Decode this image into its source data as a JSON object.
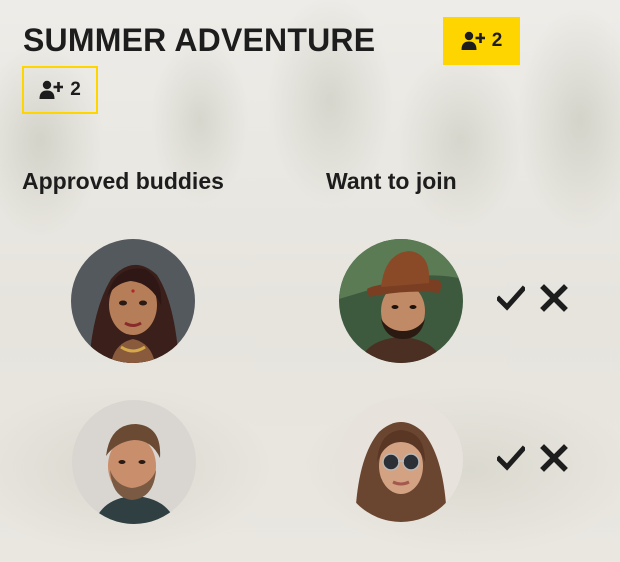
{
  "trip": {
    "title": "SUMMER ADVENTURE"
  },
  "badges": {
    "approved_count": "2",
    "requests_count": "2",
    "icon": "user-plus-icon",
    "accent_color": "#ffd500"
  },
  "columns": {
    "approved_heading": "Approved buddies",
    "want_heading": "Want to join"
  },
  "approved_buddies": [
    {
      "avatar": "avatar-woman-dark-hair"
    },
    {
      "avatar": "avatar-man-beard"
    }
  ],
  "join_requests": [
    {
      "avatar": "avatar-man-hat",
      "accept_icon": "check-icon",
      "decline_icon": "close-icon"
    },
    {
      "avatar": "avatar-woman-sunglasses",
      "accept_icon": "check-icon",
      "decline_icon": "close-icon"
    }
  ]
}
